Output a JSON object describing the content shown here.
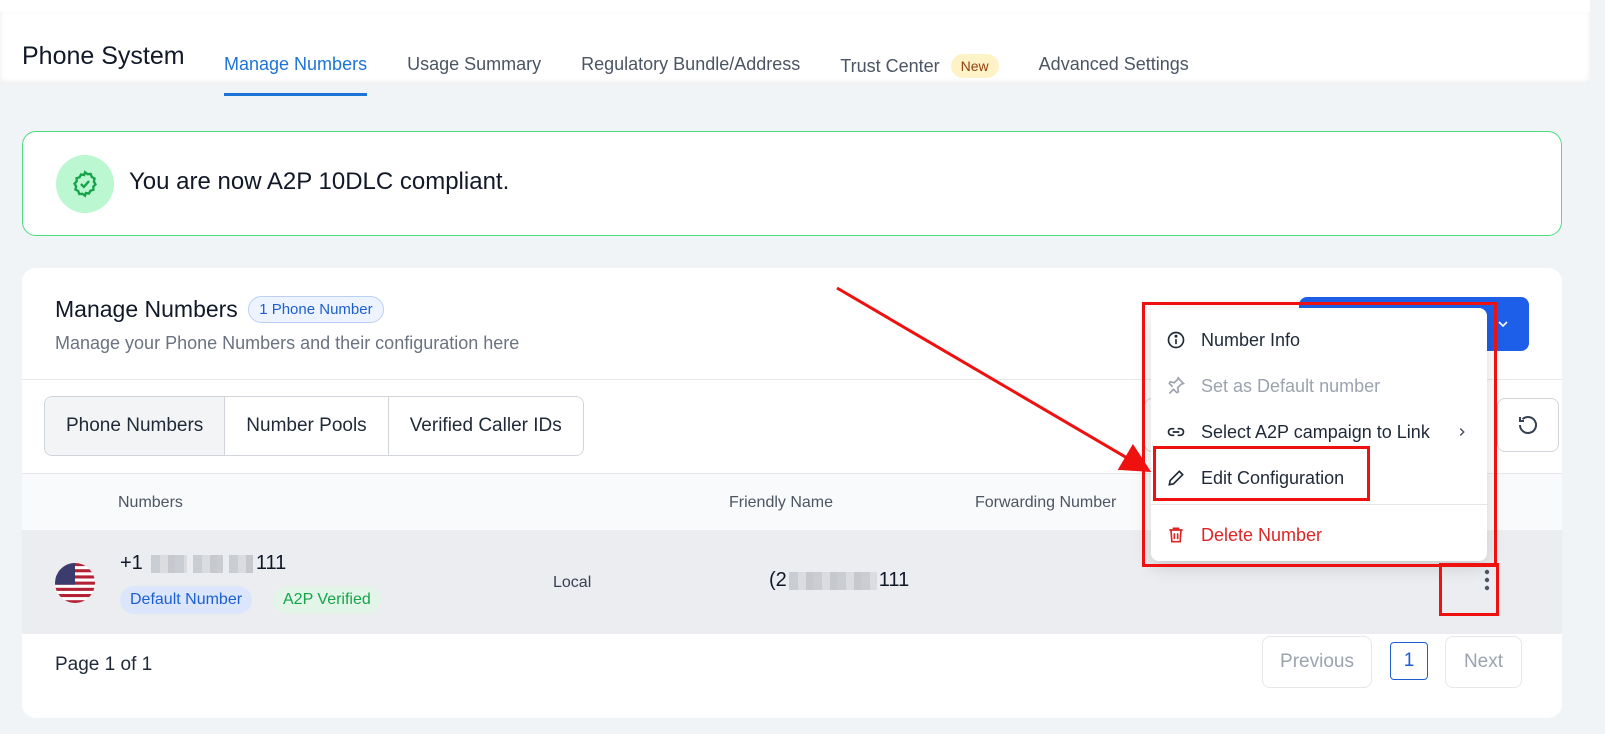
{
  "app": {
    "title": "Phone System"
  },
  "tabs": [
    {
      "label": "Manage Numbers"
    },
    {
      "label": "Usage Summary"
    },
    {
      "label": "Regulatory Bundle/Address"
    },
    {
      "label": "Trust Center",
      "badge": "New"
    },
    {
      "label": "Advanced Settings"
    }
  ],
  "banner": {
    "text": "You are now A2P 10DLC compliant."
  },
  "card": {
    "title": "Manage Numbers",
    "count_badge": "1 Phone Number",
    "subtitle": "Manage your Phone Numbers and their configuration here"
  },
  "segments": [
    {
      "label": "Phone Numbers"
    },
    {
      "label": "Number Pools"
    },
    {
      "label": "Verified Caller IDs"
    }
  ],
  "table": {
    "headers": {
      "numbers": "Numbers",
      "friendly_name": "Friendly Name",
      "forwarding": "Forwarding Number"
    },
    "rows": [
      {
        "number_prefix": "+1",
        "number_suffix": "111",
        "chip_default": "Default Number",
        "chip_a2p": "A2P Verified",
        "type": "Local",
        "friendly_prefix": "(2",
        "friendly_suffix": "111"
      }
    ]
  },
  "pagination": {
    "label": "Page 1 of 1",
    "previous": "Previous",
    "current": "1",
    "next": "Next"
  },
  "context_menu": {
    "items": [
      {
        "label": "Number Info",
        "icon": "info-icon"
      },
      {
        "label": "Set as Default number",
        "icon": "pin-icon",
        "disabled": true
      },
      {
        "label": "Select A2P campaign to Link",
        "icon": "link-icon"
      },
      {
        "label": "Edit Configuration",
        "icon": "pencil-icon"
      },
      {
        "label": "Delete Number",
        "icon": "trash-icon"
      }
    ]
  },
  "colors": {
    "accent": "#1d74d7",
    "primary_button": "#1d5fe8",
    "success": "#16a34a",
    "danger": "#dc2626",
    "annotation": "#ef1010"
  }
}
